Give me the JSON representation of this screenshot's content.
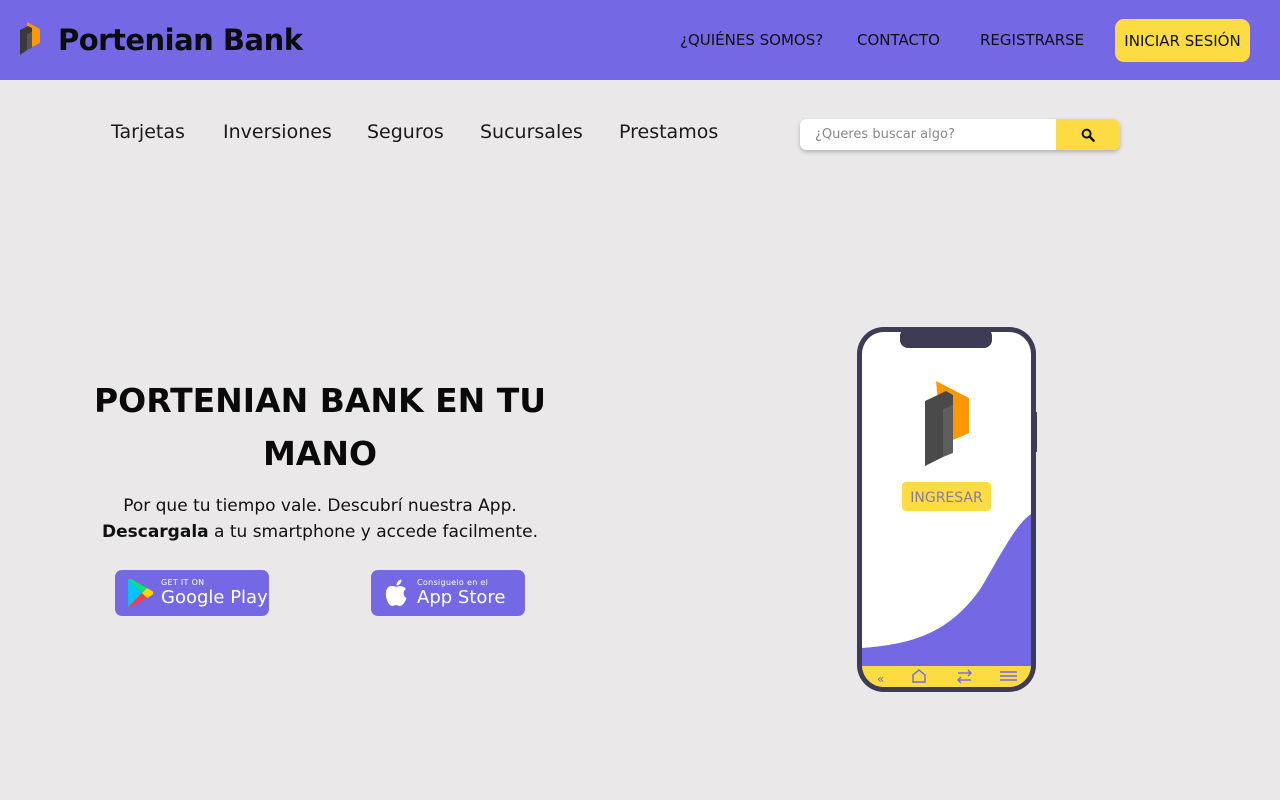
{
  "header": {
    "brand_name": "Portenian Bank",
    "nav": [
      "¿QUIÉNES SOMOS?",
      "CONTACTO",
      "REGISTRARSE"
    ],
    "login_label": "INICIAR SESIÓN"
  },
  "subnav": {
    "items": [
      "Tarjetas",
      "Inversiones",
      "Seguros",
      "Sucursales",
      "Prestamos"
    ]
  },
  "search": {
    "placeholder": "¿Queres buscar algo?"
  },
  "hero": {
    "title": "PORTENIAN BANK EN TU MANO",
    "line1": "Por que tu tiempo vale. Descubrí nuestra App.",
    "bold": "Descargala",
    "line2_rest": " a tu smartphone y accede facilmente."
  },
  "stores": {
    "google_small": "GET IT ON",
    "google_big": "Google Play",
    "apple_small": "Consiguelo en el",
    "apple_big": "App Store"
  },
  "phone": {
    "button_label": "INGRESAR",
    "nav_back_glyph": "«"
  },
  "colors": {
    "primary": "#7468e4",
    "accent": "#fcdc42",
    "background": "#eae8e8",
    "logo_orange": "#ff9800",
    "logo_dark": "#3a3a3a"
  }
}
